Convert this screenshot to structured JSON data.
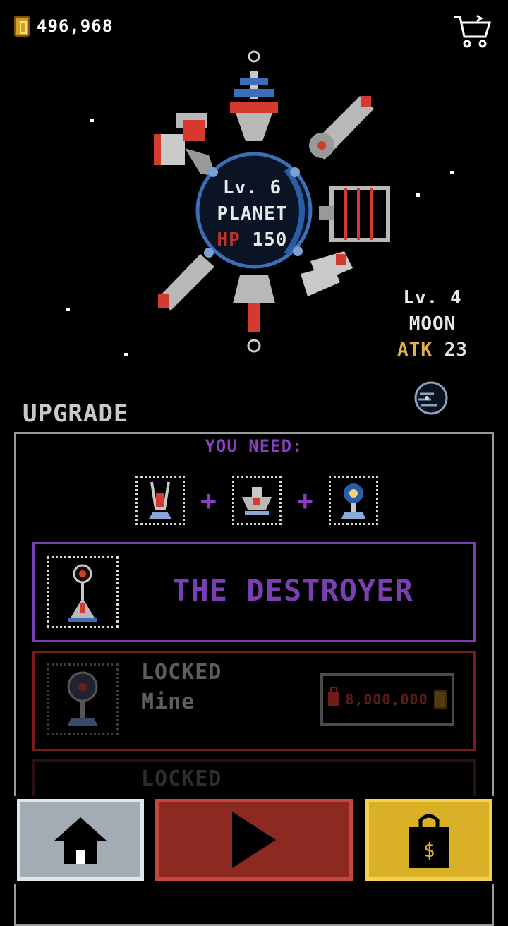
{
  "header": {
    "coins": "496,968"
  },
  "planet": {
    "level": "Lv. 6",
    "name": "PLANET",
    "hp_label": "HP",
    "hp_value": "150"
  },
  "moon": {
    "level": "Lv. 4",
    "name": "MOON",
    "atk_label": "ATK",
    "atk_value": "23"
  },
  "upgrade": {
    "title": "UPGRADE",
    "you_need": "YOU NEED:",
    "plus": "+",
    "unlocked_item": {
      "name": "THE DESTROYER"
    },
    "locked_item": {
      "status": "LOCKED",
      "name": "Mine",
      "price": "8,000,000"
    },
    "locked_item_2": {
      "status": "LOCKED"
    }
  },
  "colors": {
    "purple": "#7a3fb0",
    "red": "#8c2a22",
    "gold": "#d9b026",
    "gray": "#a3acb5"
  },
  "icons": [
    "coin-icon",
    "cart-icon",
    "moon-icon",
    "lock-icon",
    "home-icon",
    "play-icon",
    "shop-bag-icon"
  ]
}
